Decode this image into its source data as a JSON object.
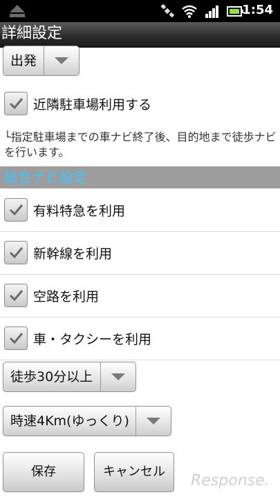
{
  "status_bar": {
    "time": "1:54"
  },
  "title_bar": {
    "title": "詳細設定"
  },
  "departure_spinner": {
    "value": "出発"
  },
  "nearby_parking": {
    "label": "近隣駐車場利用する",
    "checked": true
  },
  "parking_hint": "└指定駐車場までの車ナビ終了後、目的地まで徒歩ナビを行います。",
  "section": {
    "title": "総合ナビ設定"
  },
  "options": [
    {
      "label": "有料特急を利用",
      "checked": true
    },
    {
      "label": "新幹線を利用",
      "checked": true
    },
    {
      "label": "空路を利用",
      "checked": true
    },
    {
      "label": "車・タクシーを利用",
      "checked": true
    }
  ],
  "walk_limit_spinner": {
    "value": "徒歩30分以上"
  },
  "walk_speed_spinner": {
    "value": "時速4Km(ゆっくり)"
  },
  "buttons": {
    "save": "保存",
    "cancel": "キャンセル"
  },
  "watermark": "Response."
}
